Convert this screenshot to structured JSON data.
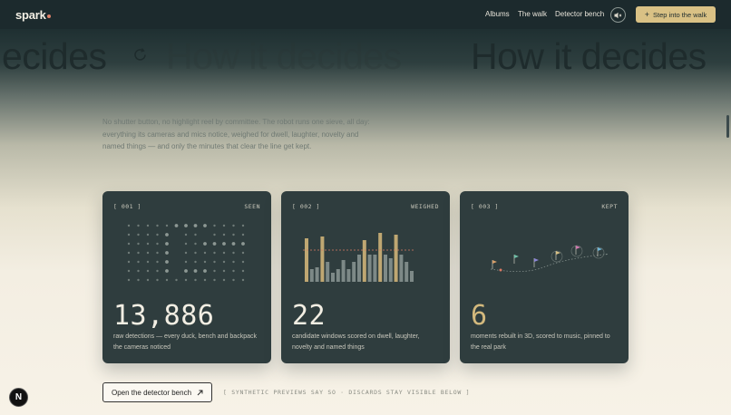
{
  "brand": {
    "name": "spark"
  },
  "nav": {
    "albums": "Albums",
    "walk": "The walk",
    "bench": "Detector bench"
  },
  "cta": {
    "label": "Step into the walk",
    "icon": "plus-icon"
  },
  "marquee": {
    "text": "How it decides",
    "fragment": "ecides"
  },
  "intro": {
    "text": "No shutter button, no highlight reel by committee. The robot runs one sieve, all day: everything its cameras and mics notice, weighed for dwell, laughter, novelty and named things — and only the minutes that clear the line get kept."
  },
  "cards": [
    {
      "id": "[ 001 ]",
      "tag": "SEEN",
      "number": "13,886",
      "desc": "raw detections — every duck, bench and backpack the cameras noticed"
    },
    {
      "id": "[ 002 ]",
      "tag": "WEIGHED",
      "number": "22",
      "desc": "candidate windows scored on dwell, laughter, novelty and named things"
    },
    {
      "id": "[ 003 ]",
      "tag": "KEPT",
      "number": "6",
      "desc": "moments rebuilt in 3D, scored to music, pinned to the real park"
    }
  ],
  "bench_button": {
    "label": "Open the detector bench",
    "icon": "arrow-up-right-icon"
  },
  "note": "[ SYNTHETIC PREVIEWS SAY SO · DISCARDS STAY VISIBLE BELOW ]",
  "badge": {
    "letter": "N"
  },
  "colors": {
    "dark": "#1c2a2d",
    "card": "#2f3d3e",
    "accent": "#d9c185",
    "cream": "#f7f2e7",
    "kept_number": "#d3b97d"
  }
}
